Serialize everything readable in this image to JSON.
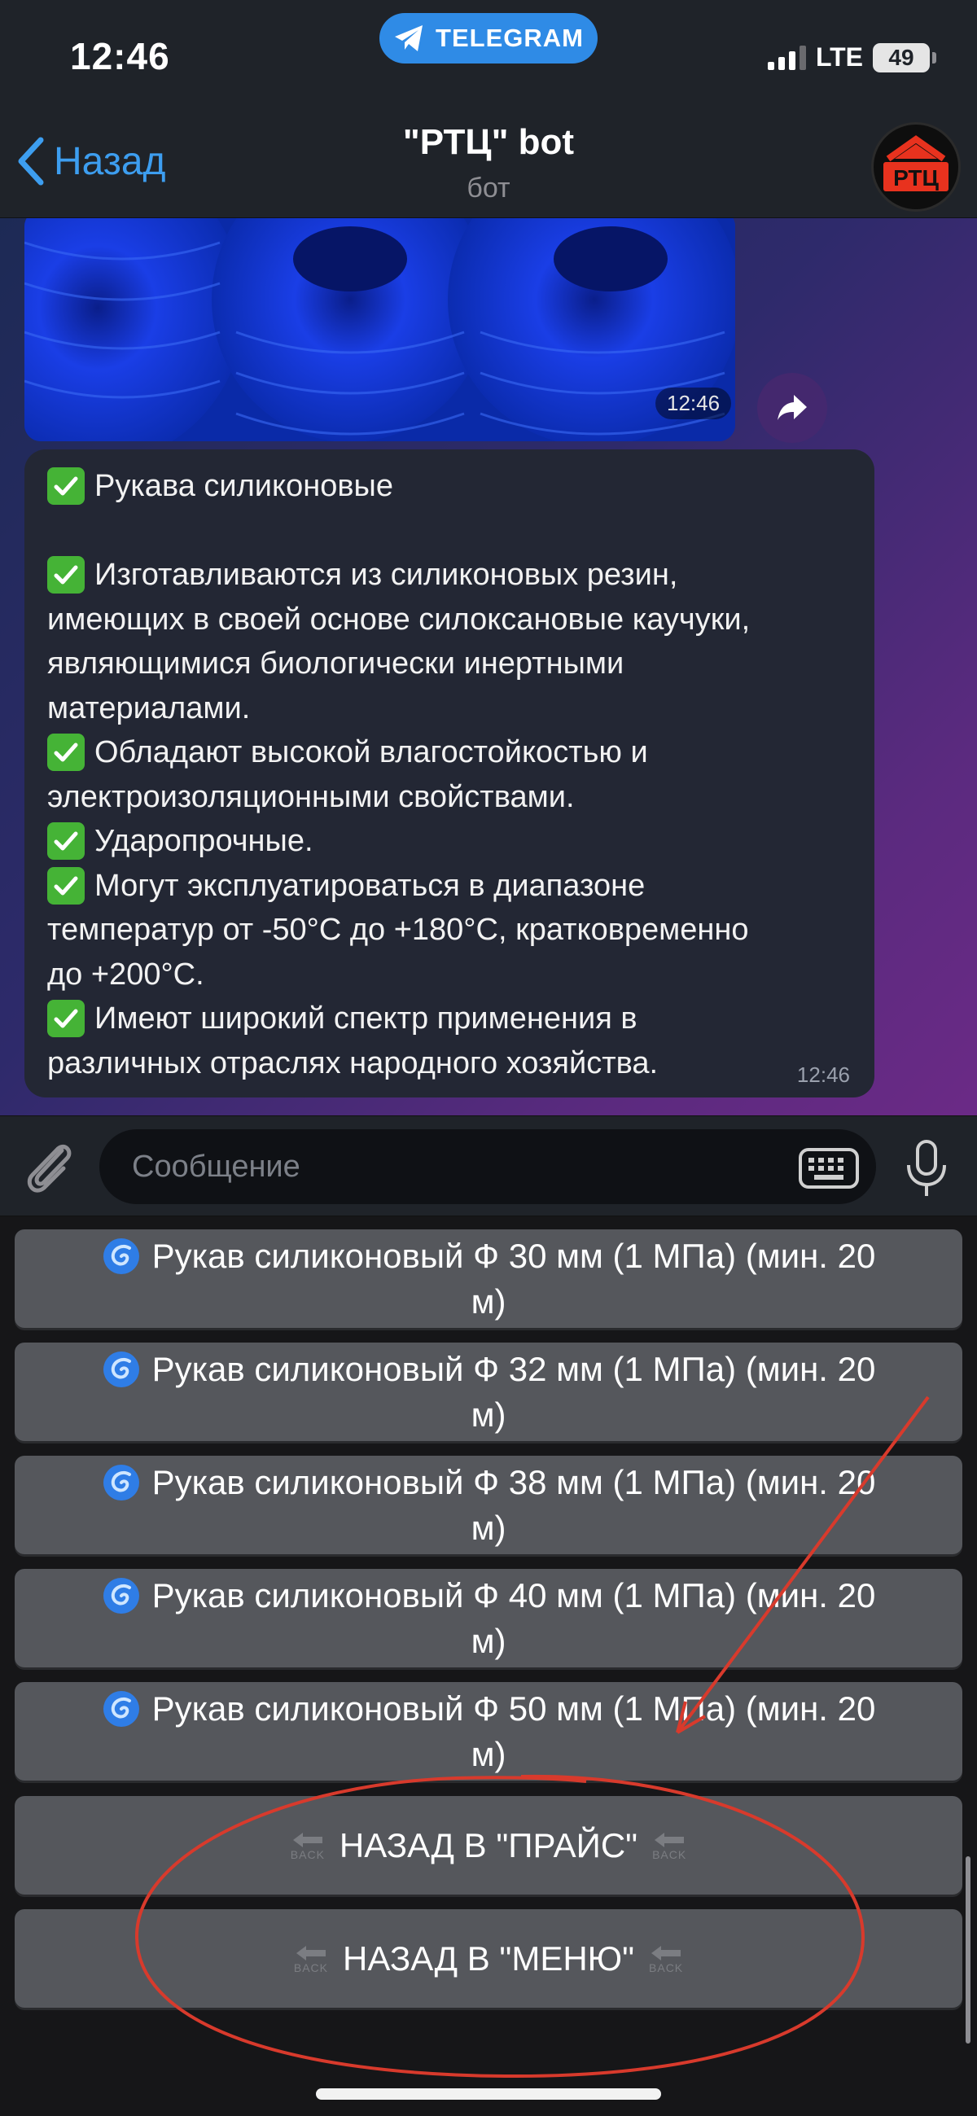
{
  "status_bar": {
    "time": "12:46",
    "app_pill": "TELEGRAM",
    "network": "LTE",
    "battery": "49"
  },
  "header": {
    "back_label": "Назад",
    "title": "\"РТЦ\" bot",
    "subtitle": "бот",
    "avatar_text": "РТЦ"
  },
  "photo_message": {
    "time": "12:46"
  },
  "text_message": {
    "lines": [
      {
        "check": true,
        "text": "Рукава силиконовые"
      },
      {
        "check": false,
        "text": ""
      },
      {
        "check": true,
        "text": "Изготавливаются из силиконовых резин,"
      },
      {
        "check": false,
        "text": "имеющих в своей основе силоксановые каучуки,"
      },
      {
        "check": false,
        "text": "являющимися биологически инертными"
      },
      {
        "check": false,
        "text": "материалами."
      },
      {
        "check": true,
        "text": "Обладают высокой влагостойкостью и"
      },
      {
        "check": false,
        "text": "электроизоляционными свойствами."
      },
      {
        "check": true,
        "text": "Ударопрочные."
      },
      {
        "check": true,
        "text": "Могут эксплуатироваться в диапазоне"
      },
      {
        "check": false,
        "text": "температур от -50°C до +180°C, кратковременно"
      },
      {
        "check": false,
        "text": "до +200°C."
      },
      {
        "check": true,
        "text": "Имеют широкий спектр применения в"
      },
      {
        "check": false,
        "text": "различных отраслях народного хозяйства."
      }
    ],
    "time": "12:46"
  },
  "input": {
    "placeholder": "Сообщение"
  },
  "keyboard": {
    "products": [
      {
        "line1": "Рукав силиконовый Ф 30 мм (1 МПа) (мин. 20",
        "line2": "м)"
      },
      {
        "line1": "Рукав силиконовый Ф 32 мм (1 МПа) (мин. 20",
        "line2": "м)"
      },
      {
        "line1": "Рукав силиконовый Ф 38 мм (1 МПа) (мин. 20",
        "line2": "м)"
      },
      {
        "line1": "Рукав силиконовый Ф 40 мм (1 МПа) (мин. 20",
        "line2": "м)"
      },
      {
        "line1": "Рукав силиконовый Ф 50 мм (1 МПа) (мин. 20",
        "line2": "м)"
      }
    ],
    "back_to_price": "НАЗАД В \"ПРАЙС\"",
    "back_to_menu": "НАЗАД В \"МЕНЮ\"",
    "back_glyph_text": "BACK"
  },
  "colors": {
    "telegram_blue": "#2f8be6",
    "link_blue": "#3d9ef0",
    "check_green": "#45b336",
    "annotation_red": "#d83a2c",
    "button_gray": "#55575c"
  }
}
